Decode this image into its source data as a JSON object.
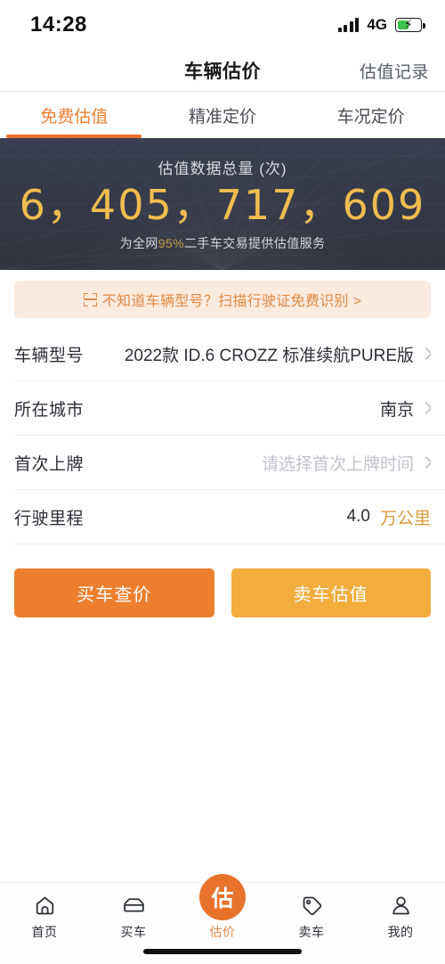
{
  "status_bar": {
    "time": "14:28",
    "network": "4G",
    "signal_icon": "signal-bars-icon",
    "battery_icon": "battery-charging-icon"
  },
  "header": {
    "title": "车辆估价",
    "right_link": "估值记录"
  },
  "tabs": [
    {
      "label": "免费估值",
      "active": true
    },
    {
      "label": "精准定价",
      "active": false
    },
    {
      "label": "车况定价",
      "active": false
    }
  ],
  "banner": {
    "label": "估值数据总量 (次)",
    "number": "6，405，717，609",
    "subtitle_prefix": "为全网",
    "subtitle_percent": "95%",
    "subtitle_suffix": "二手车交易提供估值服务",
    "bg_color": "#363b4a",
    "number_color": "#f0bd4e"
  },
  "scan_banner": {
    "icon": "scan-frame-icon",
    "text": "不知道车辆型号？扫描行驶证免费识别 >",
    "bg_color": "#fbeade",
    "text_color": "#e08a46"
  },
  "form": {
    "rows": [
      {
        "label": "车辆型号",
        "value": "2022款 ID.6 CROZZ 标准续航PURE版",
        "placeholder": false,
        "chevron": true
      },
      {
        "label": "所在城市",
        "value": "南京",
        "placeholder": false,
        "chevron": true
      },
      {
        "label": "首次上牌",
        "value": "请选择首次上牌时间",
        "placeholder": true,
        "chevron": true
      },
      {
        "label": "行驶里程",
        "value": "4.0",
        "unit": "万公里",
        "placeholder": false,
        "chevron": false
      }
    ]
  },
  "actions": {
    "buy_label": "买车查价",
    "buy_color": "#ec7f2d",
    "sell_label": "卖车估值",
    "sell_color": "#f2ad3c"
  },
  "bottom_nav": {
    "items": [
      {
        "label": "首页",
        "icon": "home-icon",
        "active": false
      },
      {
        "label": "买车",
        "icon": "car-icon",
        "active": false
      },
      {
        "label": "估价",
        "icon": "appraise-badge-icon",
        "badge_text": "估",
        "active": true
      },
      {
        "label": "卖车",
        "icon": "price-tag-icon",
        "active": false
      },
      {
        "label": "我的",
        "icon": "person-icon",
        "active": false
      }
    ],
    "active_color": "#e8722a"
  }
}
